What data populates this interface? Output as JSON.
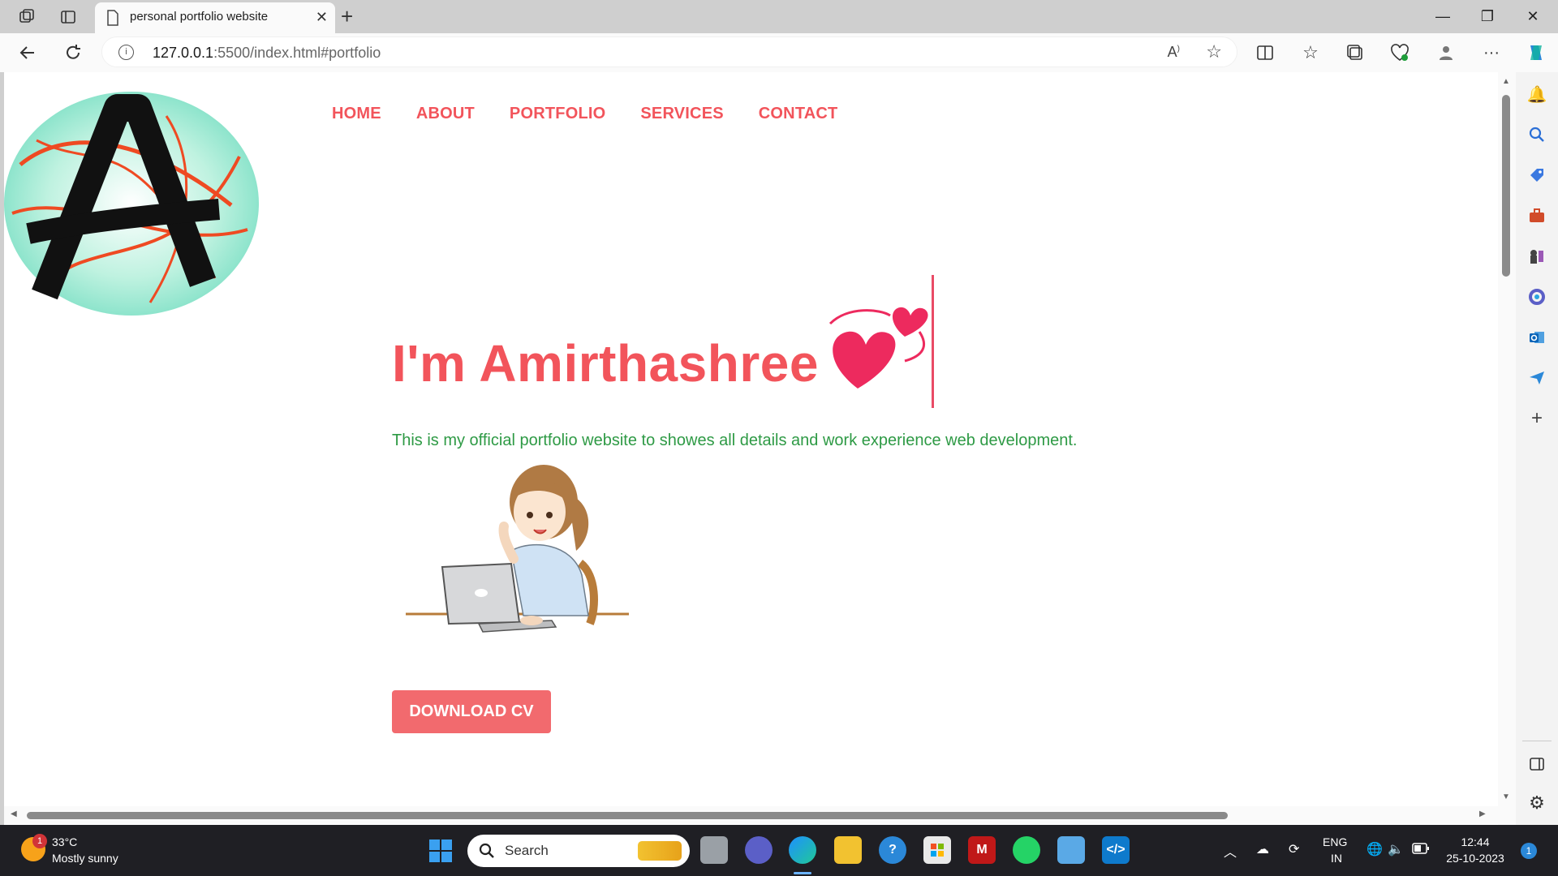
{
  "browser": {
    "tab_title": "personal portfolio website",
    "url_host": "127.0.0.1",
    "url_rest": ":5500/index.html#portfolio"
  },
  "nav": {
    "items": [
      "HOME",
      "ABOUT",
      "PORTFOLIO",
      "SERVICES",
      "CONTACT"
    ]
  },
  "hero": {
    "title": "I'm Amirthashree",
    "tagline": "This is my official portfolio website to showes all details and work experience web development.",
    "cta": "DOWNLOAD CV"
  },
  "logo": {
    "letter": "A"
  },
  "taskbar": {
    "weather_temp": "33°C",
    "weather_desc": "Mostly sunny",
    "weather_badge": "1",
    "search_label": "Search",
    "lang_top": "ENG",
    "lang_bottom": "IN",
    "time": "12:44",
    "date": "25-10-2023",
    "notif_count": "1"
  },
  "colors": {
    "accent": "#f2545b",
    "tagline": "#2e9a45",
    "button": "#f26a6e"
  }
}
